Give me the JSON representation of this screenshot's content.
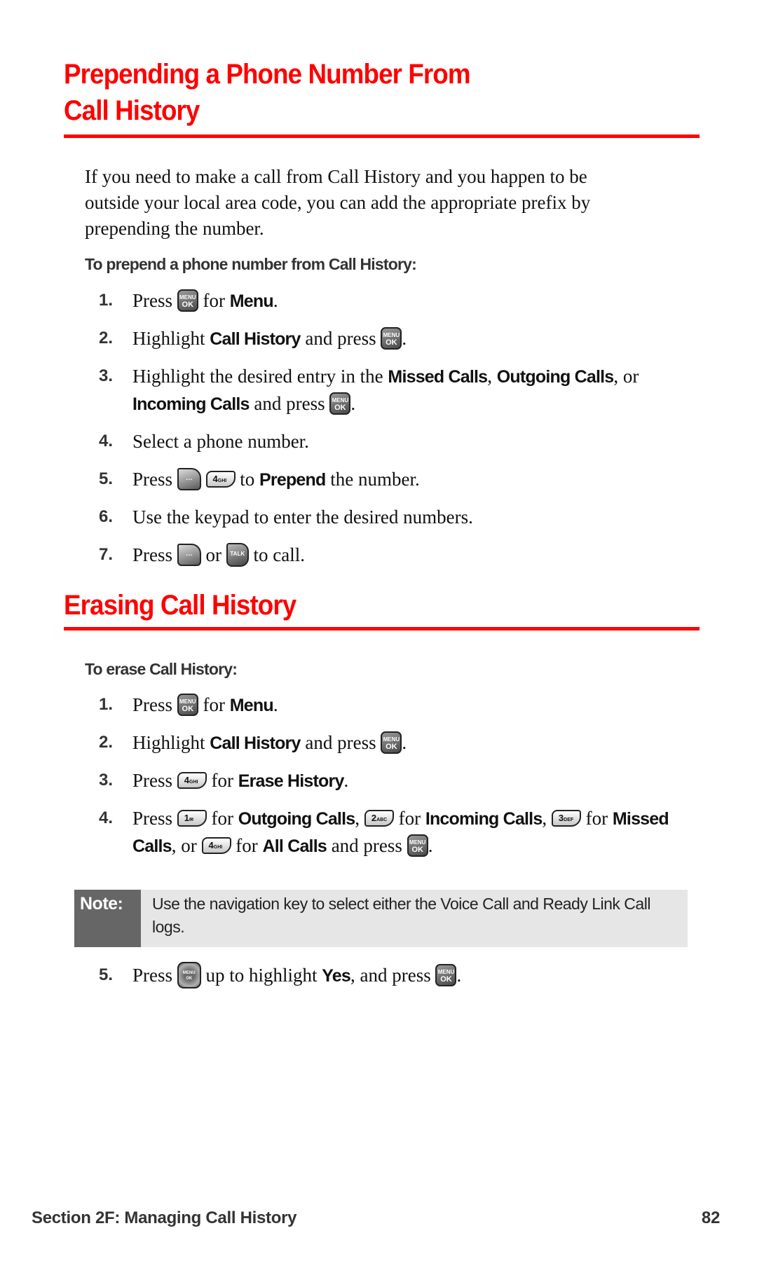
{
  "section1": {
    "title_line1": "Prepending a Phone Number From",
    "title_line2": "Call History",
    "intro_line1": "If you need to make a call from Call History and you happen to be",
    "intro_line2": "outside your local area code, you can add the appropriate prefix by",
    "intro_line3": "prepending the number.",
    "subhead": "To prepend a phone number from Call History:",
    "steps": [
      {
        "num": "1.",
        "t1": "Press",
        "t2": "for",
        "b1": "Menu",
        "t3": "."
      },
      {
        "num": "2.",
        "t1": "Highlight",
        "b1": "Call History",
        "t2": "and press",
        "t3": "."
      },
      {
        "num": "3.",
        "t1": "Highlight the desired entry in the",
        "b1": "Missed Calls",
        "t2": ",",
        "b2": "Outgoing Calls",
        "t3": ",",
        "t4": "or",
        "b3": "Incoming Calls",
        "t5": "and press",
        "t6": "."
      },
      {
        "num": "4.",
        "t1": "Select a phone number."
      },
      {
        "num": "5.",
        "t1": "Press",
        "t2": "to",
        "b1": "Prepend",
        "t3": "the number."
      },
      {
        "num": "6.",
        "t1": "Use the keypad to enter the desired numbers."
      },
      {
        "num": "7.",
        "t1": "Press",
        "t2": "or",
        "t3": "to call."
      }
    ]
  },
  "section2": {
    "title": "Erasing Call History",
    "subhead": "To erase Call History:",
    "steps": [
      {
        "num": "1.",
        "t1": "Press",
        "t2": "for",
        "b1": "Menu",
        "t3": "."
      },
      {
        "num": "2.",
        "t1": "Highlight",
        "b1": "Call History",
        "t2": "and press",
        "t3": "."
      },
      {
        "num": "3.",
        "t1": "Press",
        "t2": "for",
        "b1": "Erase History",
        "t3": "."
      },
      {
        "num": "4.",
        "t1": "Press",
        "t2": "for",
        "b1": "Outgoing Calls",
        "t3": ",",
        "t4": "for",
        "b2": "Incoming Calls",
        "t5": ",",
        "t6": "for",
        "b3": "Missed Calls",
        "t7": ", or",
        "t8": "for",
        "b4": "All Calls",
        "t9": "and press",
        "t10": "."
      },
      {
        "num": "5.",
        "t1": "Press",
        "t2": "up to highlight",
        "b1": "Yes",
        "t3": ", and press",
        "t4": "."
      }
    ],
    "note_label": "Note:",
    "note_text": "Use the navigation key to select either the Voice Call and Ready Link Call logs."
  },
  "keys": {
    "menu_top": "MENU",
    "menu_bottom": "OK",
    "soft": "…",
    "talk": "TALK",
    "k1": "1",
    "k1_sub": "✉",
    "k2": "2",
    "k2_sub": "ABC",
    "k3": "3",
    "k3_sub": "DEF",
    "k4": "4",
    "k4_sub": "GHI"
  },
  "footer": {
    "section": "Section 2F: Managing Call History",
    "page": "82"
  }
}
